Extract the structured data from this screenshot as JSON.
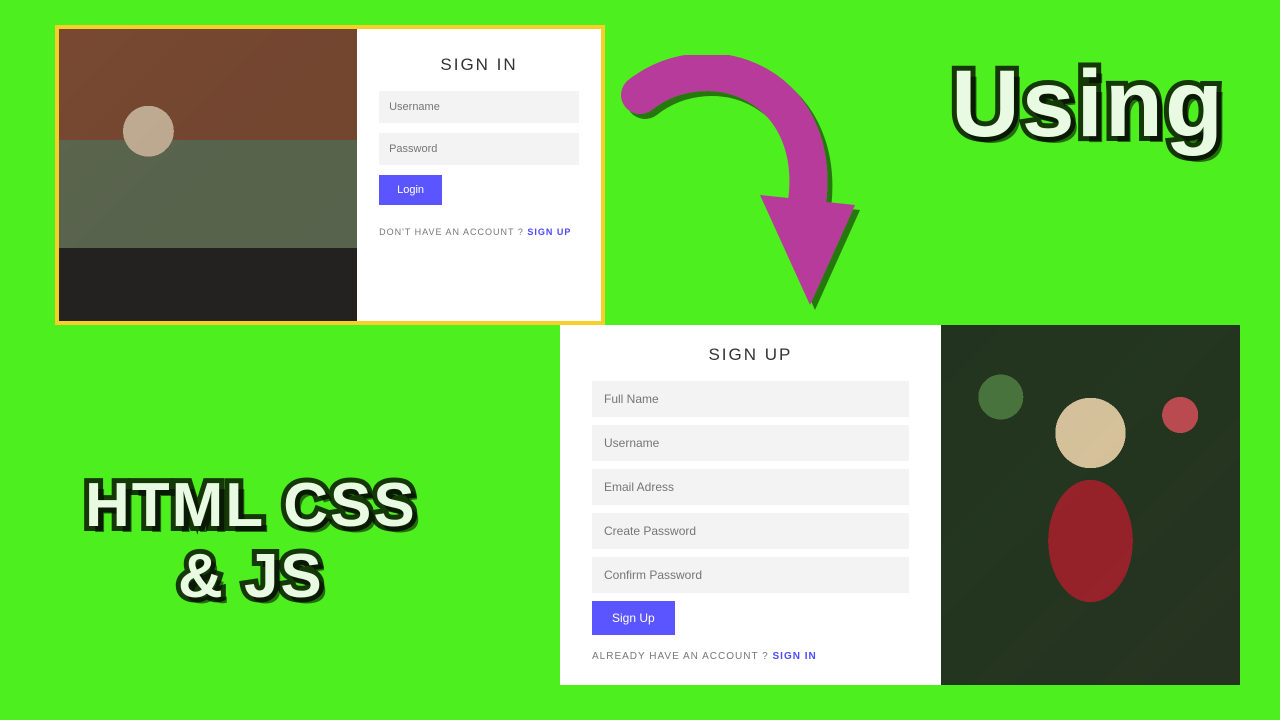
{
  "labels": {
    "using": "Using",
    "htmlcssjs_line1": "HTML CSS",
    "htmlcssjs_line2": "& JS"
  },
  "signin": {
    "heading": "SIGN IN",
    "username_placeholder": "Username",
    "password_placeholder": "Password",
    "button": "Login",
    "switch_prefix": "DON'T HAVE AN ACCOUNT ? ",
    "switch_link": "SIGN UP"
  },
  "signup": {
    "heading": "SIGN UP",
    "fullname_placeholder": "Full Name",
    "username_placeholder": "Username",
    "email_placeholder": "Email Adress",
    "create_pw_placeholder": "Create Password",
    "confirm_pw_placeholder": "Confirm Password",
    "button": "Sign Up",
    "switch_prefix": "ALREADY HAVE AN ACCOUNT ? ",
    "switch_link": "SIGN IN"
  },
  "colors": {
    "background": "#4eef1e",
    "accent_button": "#5a55ff",
    "border_yellow": "#f6cf28",
    "arrow": "#b73a9a"
  }
}
